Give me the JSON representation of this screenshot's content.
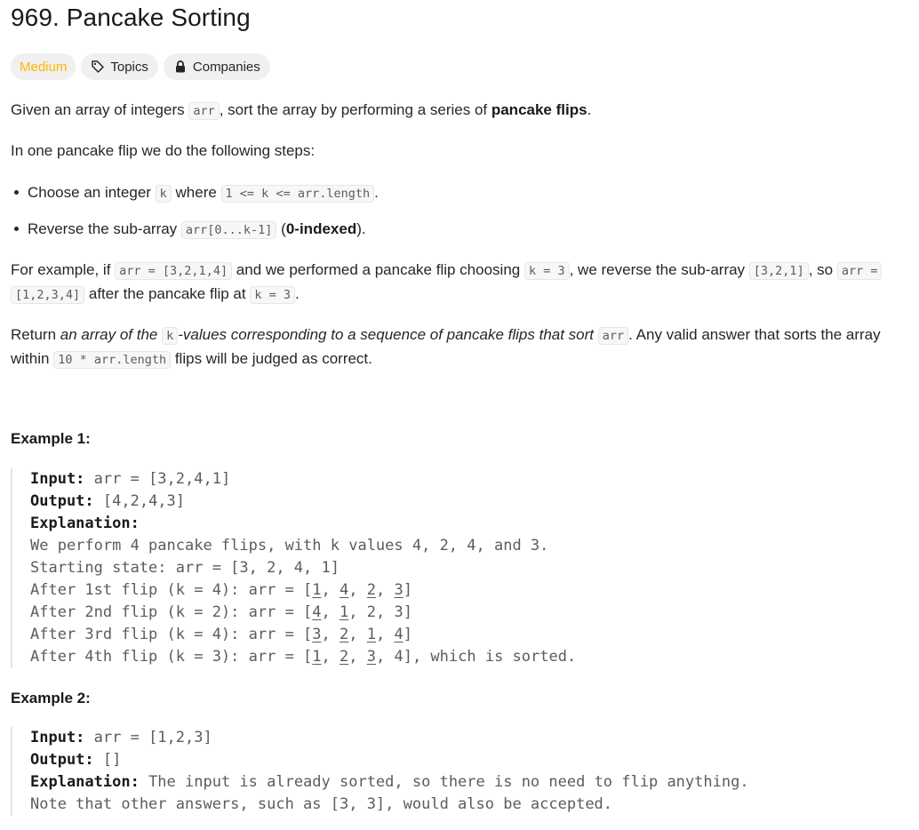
{
  "problem": {
    "title": "969. Pancake Sorting",
    "difficulty": "Medium",
    "topics_label": "Topics",
    "companies_label": "Companies"
  },
  "description": {
    "p1": {
      "t1": "Given an array of integers ",
      "c1": "arr",
      "t2": ", sort the array by performing a series of ",
      "b1": "pancake flips",
      "t3": "."
    },
    "p2": "In one pancake flip we do the following steps:",
    "bullet1": {
      "t1": "Choose an integer ",
      "c1": "k",
      "t2": " where ",
      "c2": "1 <= k <= arr.length",
      "t3": "."
    },
    "bullet2": {
      "t1": "Reverse the sub-array ",
      "c1": "arr[0...k-1]",
      "t2": " (",
      "b1": "0-indexed",
      "t3": ")."
    },
    "p3": {
      "t1": "For example, if ",
      "c1": "arr = [3,2,1,4]",
      "t2": " and we performed a pancake flip choosing ",
      "c2": "k = 3",
      "t3": ", we reverse the sub-array ",
      "c3": "[3,2,1]",
      "t4": ", so ",
      "c4": "arr =",
      "c5": "[1,2,3,4]",
      "t5": " after the pancake flip at ",
      "c6": "k = 3",
      "t6": "."
    },
    "p4": {
      "t1": "Return ",
      "i1": "an array of the ",
      "c1": "k",
      "i2": "-values corresponding to a sequence of pancake flips that sort ",
      "c2": "arr",
      "t2": ". Any valid answer that sorts the array",
      "t3": "within ",
      "c3": "10 * arr.length",
      "t4": " flips will be judged as correct."
    }
  },
  "examples": [
    {
      "heading": "Example 1:",
      "input_label": "Input:",
      "input": " arr = [3,2,4,1]",
      "output_label": "Output:",
      "output": " [4,2,4,3]",
      "explanation_label": "Explanation:",
      "lines": [
        "We perform 4 pancake flips, with k values 4, 2, 4, and 3.",
        "Starting state: arr = [3, 2, 4, 1]"
      ],
      "flips": [
        {
          "prefix": "After 1st flip (k = 4): arr = [",
          "u": [
            "1",
            "4",
            "2",
            "3"
          ],
          "rest": "",
          "suffix": "]"
        },
        {
          "prefix": "After 2nd flip (k = 2): arr = [",
          "u": [
            "4",
            "1"
          ],
          "rest": ", 2, 3",
          "suffix": "]"
        },
        {
          "prefix": "After 3rd flip (k = 4): arr = [",
          "u": [
            "3",
            "2",
            "1",
            "4"
          ],
          "rest": "",
          "suffix": "]"
        },
        {
          "prefix": "After 4th flip (k = 3): arr = [",
          "u": [
            "1",
            "2",
            "3"
          ],
          "rest": ", 4",
          "suffix": "], which is sorted."
        }
      ]
    },
    {
      "heading": "Example 2:",
      "input_label": "Input:",
      "input": " arr = [1,2,3]",
      "output_label": "Output:",
      "output": " []",
      "explanation_label": "Explanation:",
      "explanation_inline": " The input is already sorted, so there is no need to flip anything.",
      "note": "Note that other answers, such as [3, 3], would also be accepted."
    }
  ]
}
